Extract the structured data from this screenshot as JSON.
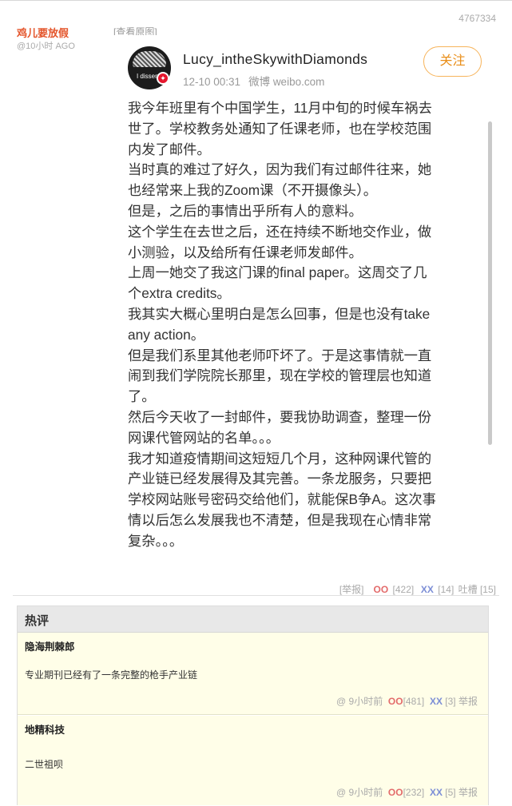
{
  "post": {
    "id": "4767334",
    "author": "鸡儿要放假",
    "time_ago": "@10小时 AGO",
    "view_original": "[查看原图]",
    "report": "[举报]",
    "oo_label": "OO",
    "oo_count": "[422]",
    "xx_label": "XX",
    "xx_count": "[14]",
    "complain": "吐槽 [15]"
  },
  "weibo": {
    "avatar_text": "I dissent.",
    "username": "Lucy_intheSkywithDiamonds",
    "date": "12-10 00:31",
    "source": "微博 weibo.com",
    "follow_label": "关注",
    "lines": [
      "我今年班里有个中国学生，11月中旬的时候车祸去",
      "世了。学校教务处通知了任课老师，也在学校范围",
      "内发了邮件。",
      "当时真的难过了好久，因为我们有过邮件往来，她",
      "也经常来上我的Zoom课（不开摄像头）。",
      "但是，之后的事情出乎所有人的意料。",
      "这个学生在去世之后，还在持续不断地交作业，做",
      "小测验，以及给所有任课老师发邮件。",
      "上周一她交了我这门课的final paper。这周交了几",
      "个extra credits。",
      "我其实大概心里明白是怎么回事，但是也没有take",
      "any action。",
      "但是我们系里其他老师吓坏了。于是这事情就一直",
      "闹到我们学院院长那里，现在学校的管理层也知道",
      "了。",
      "然后今天收了一封邮件，要我协助调查，整理一份",
      "网课代管网站的名单。。。",
      "我才知道疫情期间这短短几个月，这种网课代管的",
      "产业链已经发展得及其完善。一条龙服务，只要把",
      "学校网站账号密码交给他们，就能保B争A。这次事",
      "情以后怎么发展我也不清楚，但是我现在心情非常",
      "复杂。。。"
    ]
  },
  "hot_comments": {
    "title": "热评",
    "items": [
      {
        "name": "隐海荆棘郎",
        "text": "专业期刊已经有了一条完整的枪手产业链",
        "at": "@",
        "time": "9小时前",
        "oo_label": "OO",
        "oo": "[481]",
        "xx_label": "XX",
        "xx": "[3]",
        "report": "举报"
      },
      {
        "name": "地精科技",
        "text": "二世祖呗",
        "at": "@",
        "time": "9小时前",
        "oo_label": "OO",
        "oo": "[232]",
        "xx_label": "XX",
        "xx": "[5]",
        "report": "举报"
      }
    ]
  }
}
